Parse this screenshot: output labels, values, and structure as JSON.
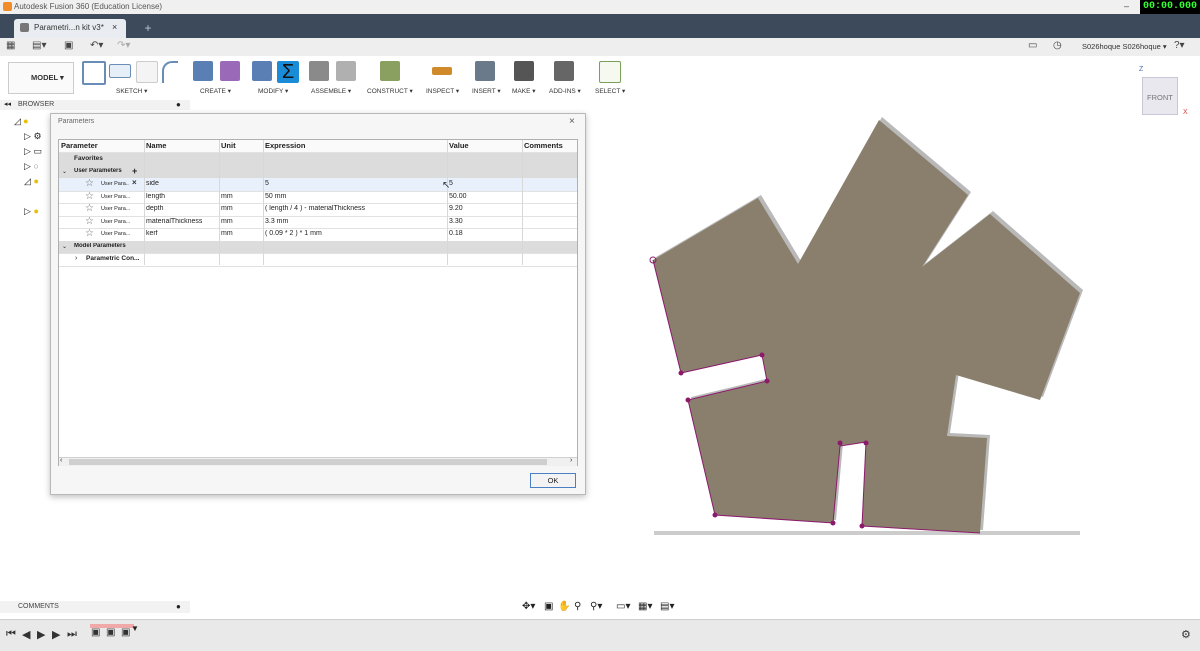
{
  "window": {
    "title": "Autodesk Fusion 360 (Education License)",
    "minimize": "–",
    "maximize": "□",
    "timer": "00:00.000"
  },
  "document_tab": {
    "label": "Parametri...n kit v3*",
    "close": "×",
    "new_tab": "+"
  },
  "quick_access": {
    "user": "S026hoque S026hoque ▾",
    "help": "?▾"
  },
  "toolbar": {
    "workspace": "MODEL ▾",
    "groups": [
      {
        "label": "SKETCH ▾",
        "color": "#6a8db8"
      },
      {
        "label": "CREATE ▾",
        "color": "#5a7fb5"
      },
      {
        "label": "MODIFY ▾",
        "color": "#2a72c2"
      },
      {
        "label": "ASSEMBLE ▾",
        "color": "#7a7a7a"
      },
      {
        "label": "CONSTRUCT ▾",
        "color": "#8aa060"
      },
      {
        "label": "INSPECT ▾",
        "color": "#d08a2a"
      },
      {
        "label": "INSERT ▾",
        "color": "#6a7a8a"
      },
      {
        "label": "MAKE ▾",
        "color": "#555555"
      },
      {
        "label": "ADD-INS ▾",
        "color": "#666666"
      },
      {
        "label": "SELECT ▾",
        "color": "#7aa05a"
      }
    ]
  },
  "browser": {
    "title": "BROWSER"
  },
  "comments": {
    "title": "COMMENTS"
  },
  "dialog": {
    "title": "Parameters",
    "close": "×",
    "columns": [
      "Parameter",
      "Name",
      "Unit",
      "Expression",
      "Value",
      "Comments"
    ],
    "favorites": "Favorites",
    "user_params_group": "User Parameters",
    "add": "+",
    "rows": [
      {
        "param": "User Para...",
        "name": "side",
        "unit": "",
        "expression": "5",
        "value": "5"
      },
      {
        "param": "User Para...",
        "name": "length",
        "unit": "mm",
        "expression": "50 mm",
        "value": "50.00"
      },
      {
        "param": "User Para...",
        "name": "depth",
        "unit": "mm",
        "expression": "( length / 4 ) - materialThickness",
        "value": "9.20"
      },
      {
        "param": "User Para...",
        "name": "materialThickness",
        "unit": "mm",
        "expression": "3.3 mm",
        "value": "3.30"
      },
      {
        "param": "User Para...",
        "name": "kerf",
        "unit": "mm",
        "expression": "( 0.09 * 2 ) * 1 mm",
        "value": "0.18"
      }
    ],
    "model_params_group": "Model Parameters",
    "parametric_row": "Parametric Con...",
    "ok": "OK"
  },
  "viewcube": {
    "face": "FRONT",
    "z": "Z",
    "x": "X"
  },
  "colors": {
    "part_fill": "#8a7f6c",
    "part_side": "#b9b9b9",
    "sketch_line": "#8b1a6b",
    "tab_strip": "#3c4a5c"
  }
}
